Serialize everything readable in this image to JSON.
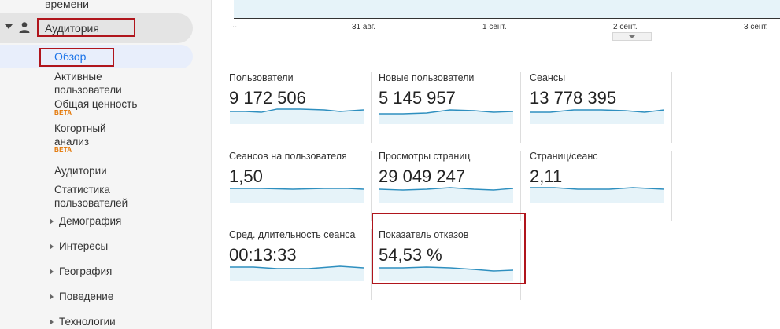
{
  "sidebar": {
    "prev_item": "времени",
    "audience_label": "Аудитория",
    "overview_label": "Обзор",
    "items": [
      {
        "label": "Активные пользователи"
      },
      {
        "label": "Общая ценность",
        "badge": "BETA"
      },
      {
        "label": "Когортный анализ",
        "badge": "BETA"
      },
      {
        "label": "Аудитории"
      },
      {
        "label": "Статистика пользователей"
      }
    ],
    "subgroups": [
      "Демография",
      "Интересы",
      "География",
      "Поведение",
      "Технологии"
    ]
  },
  "timeline": {
    "ellipsis": "...",
    "ticks": [
      "31 авг.",
      "1 сент.",
      "2 сент.",
      "3 сент."
    ]
  },
  "metrics": [
    {
      "title": "Пользователи",
      "value": "9 172 506"
    },
    {
      "title": "Новые пользователи",
      "value": "5 145 957"
    },
    {
      "title": "Сеансы",
      "value": "13 778 395"
    },
    {
      "title": "Сеансов на пользователя",
      "value": "1,50"
    },
    {
      "title": "Просмотры страниц",
      "value": "29 049 247"
    },
    {
      "title": "Страниц/сеанс",
      "value": "2,11"
    },
    {
      "title": "Сред. длительность сеанса",
      "value": "00:13:33"
    },
    {
      "title": "Показатель отказов",
      "value": "54,53 %"
    }
  ],
  "colors": {
    "accent": "#1a73e8",
    "highlight_border": "#b0151c",
    "spark_line": "#2e8fbf",
    "spark_fill": "#e6f3f9",
    "beta": "#e37400"
  }
}
